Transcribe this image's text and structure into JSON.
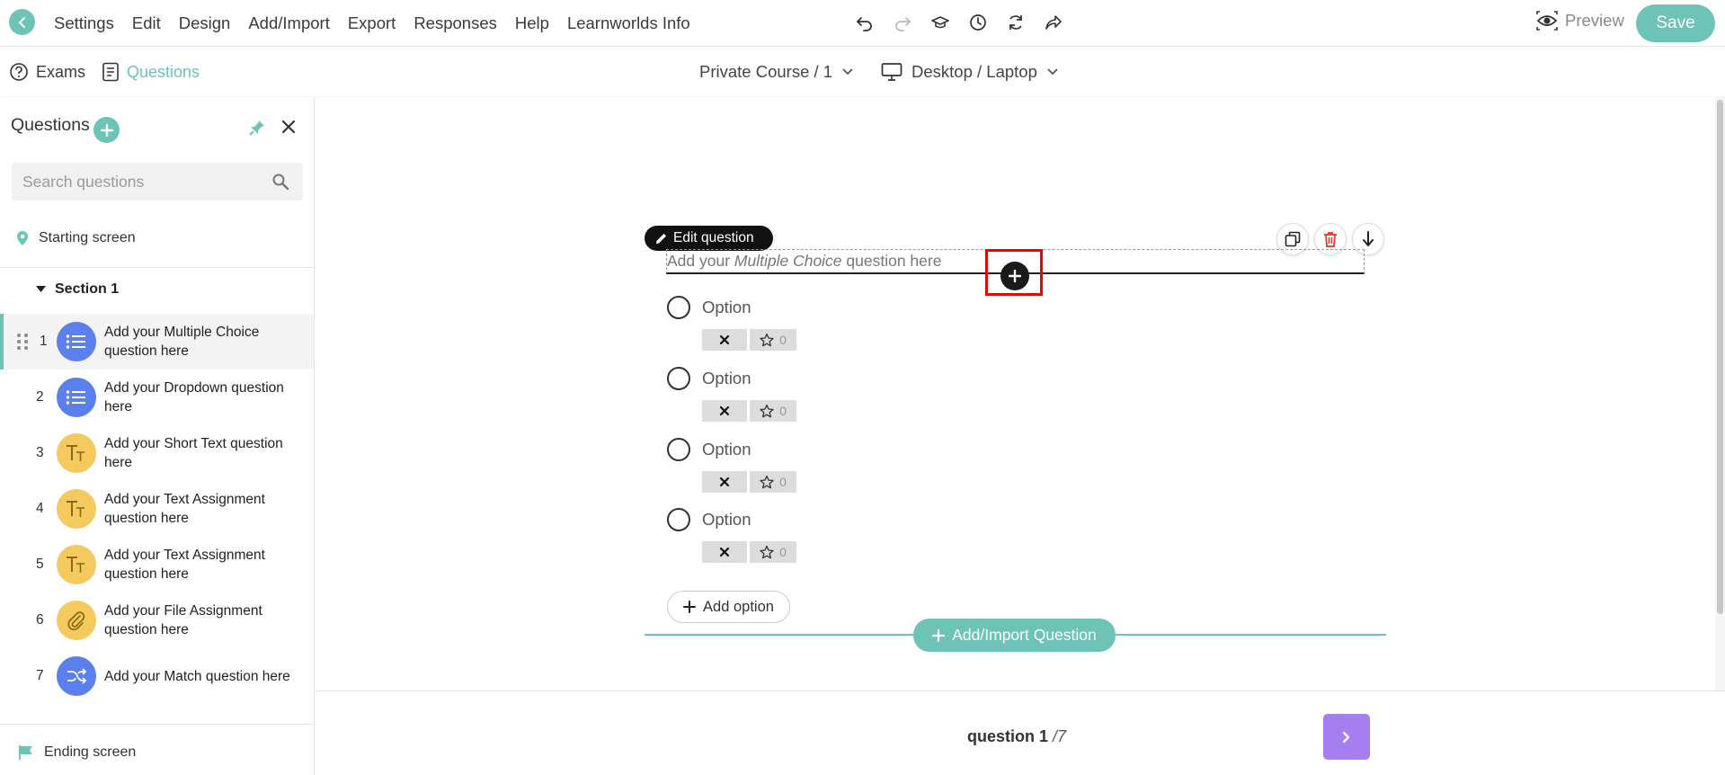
{
  "topbar": {
    "menu": [
      "Settings",
      "Edit",
      "Design",
      "Add/Import",
      "Export",
      "Responses",
      "Help",
      "Learnworlds Info"
    ],
    "preview_label": "Preview",
    "save_label": "Save",
    "accent_color": "#6cc3b6"
  },
  "subbar": {
    "tabs": [
      {
        "label": "Exams",
        "icon": "help-circle-icon"
      },
      {
        "label": "Questions",
        "icon": "document-icon",
        "active": true
      }
    ],
    "course": "Private Course / 1",
    "device": "Desktop / Laptop"
  },
  "sidebar": {
    "title": "Questions",
    "search_placeholder": "Search questions",
    "starting_screen": "Starting screen",
    "section": "Section 1",
    "ending_screen": "Ending screen",
    "questions": [
      {
        "num": "1",
        "label": "Add your Multiple Choice question here",
        "icon": "list-icon",
        "color": "#5b7fed",
        "active": true
      },
      {
        "num": "2",
        "label": "Add your Dropdown question here",
        "icon": "list-icon",
        "color": "#5b7fed"
      },
      {
        "num": "3",
        "label": "Add your Short Text question here",
        "icon": "text-icon",
        "color": "#f4c95d"
      },
      {
        "num": "4",
        "label": "Add your Text Assignment question here",
        "icon": "text-icon",
        "color": "#f4c95d"
      },
      {
        "num": "5",
        "label": "Add your Text Assignment question here",
        "icon": "text-icon",
        "color": "#f4c95d"
      },
      {
        "num": "6",
        "label": "Add your File Assignment question here",
        "icon": "paperclip-icon",
        "color": "#f4c95d"
      },
      {
        "num": "7",
        "label": "Add your Match question here",
        "icon": "shuffle-icon",
        "color": "#5b7fed"
      }
    ]
  },
  "editor": {
    "edit_label": "Edit question",
    "question_prefix": "Add your ",
    "question_emphasis": "Multiple Choice",
    "question_suffix": " question here",
    "options": [
      {
        "label": "Option",
        "score": "0"
      },
      {
        "label": "Option",
        "score": "0"
      },
      {
        "label": "Option",
        "score": "0"
      },
      {
        "label": "Option",
        "score": "0"
      }
    ],
    "add_option_label": "Add option",
    "add_import_label": "Add/Import Question"
  },
  "footer": {
    "counter_word": "question",
    "current": "1",
    "total": "/7"
  }
}
